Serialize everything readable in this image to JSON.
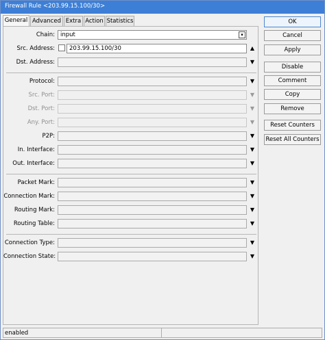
{
  "window": {
    "title": "Firewall Rule <203.99.15.100/30>"
  },
  "tabs": [
    {
      "label": "General",
      "active": true
    },
    {
      "label": "Advanced",
      "active": false
    },
    {
      "label": "Extra",
      "active": false
    },
    {
      "label": "Action",
      "active": false
    },
    {
      "label": "Statistics",
      "active": false
    }
  ],
  "fields": {
    "chain": {
      "label": "Chain:",
      "value": "input"
    },
    "src_address": {
      "label": "Src. Address:",
      "value": "203.99.15.100/30"
    },
    "dst_address": {
      "label": "Dst. Address:",
      "value": ""
    },
    "protocol": {
      "label": "Protocol:",
      "value": ""
    },
    "src_port": {
      "label": "Src. Port:",
      "value": ""
    },
    "dst_port": {
      "label": "Dst. Port:",
      "value": ""
    },
    "any_port": {
      "label": "Any. Port:",
      "value": ""
    },
    "p2p": {
      "label": "P2P:",
      "value": ""
    },
    "in_interface": {
      "label": "In. Interface:",
      "value": ""
    },
    "out_interface": {
      "label": "Out. Interface:",
      "value": ""
    },
    "packet_mark": {
      "label": "Packet Mark:",
      "value": ""
    },
    "connection_mark": {
      "label": "Connection Mark:",
      "value": ""
    },
    "routing_mark": {
      "label": "Routing Mark:",
      "value": ""
    },
    "routing_table": {
      "label": "Routing Table:",
      "value": ""
    },
    "connection_type": {
      "label": "Connection Type:",
      "value": ""
    },
    "connection_state": {
      "label": "Connection State:",
      "value": ""
    }
  },
  "glyphs": {
    "dropdown": "▼",
    "collapse": "▲",
    "select": "▾"
  },
  "buttons": {
    "ok": "OK",
    "cancel": "Cancel",
    "apply": "Apply",
    "disable": "Disable",
    "comment": "Comment",
    "copy": "Copy",
    "remove": "Remove",
    "reset_counters": "Reset Counters",
    "reset_all_counters": "Reset All Counters"
  },
  "status": {
    "state": "enabled"
  },
  "colors": {
    "titlebar": "#3d7fd6",
    "ok_border": "#4e86cf"
  }
}
